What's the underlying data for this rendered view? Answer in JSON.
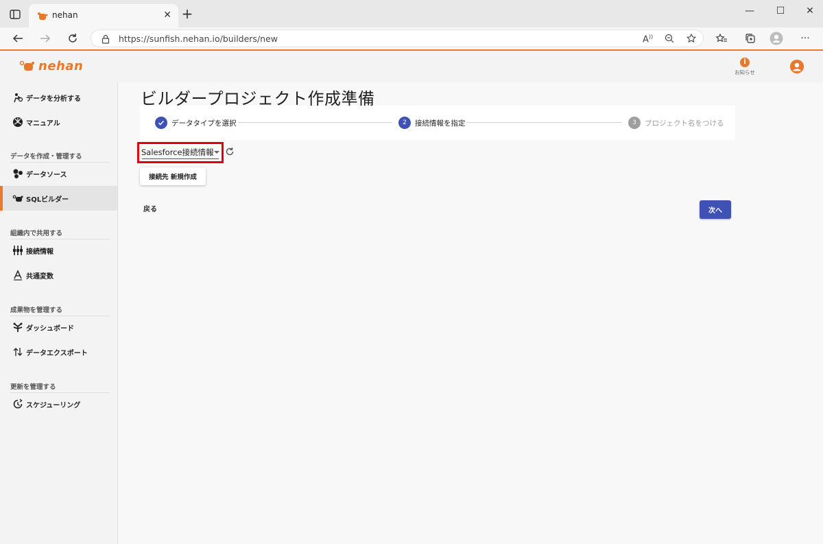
{
  "browser": {
    "tab_title": "nehan",
    "url": "https://sunfish.nehan.io/builders/new",
    "new_tab_symbol": "+",
    "close_symbol": "✕",
    "minimize_symbol": "—",
    "maximize_symbol": "☐",
    "window_close_symbol": "✕"
  },
  "header": {
    "logo_text": "nehan",
    "notification_label": "お知らせ",
    "notification_symbol": "i"
  },
  "sidebar": {
    "top_items": [
      {
        "label": "データを分析する",
        "icon": "analyze-icon"
      },
      {
        "label": "マニュアル",
        "icon": "manual-icon"
      }
    ],
    "sections": [
      {
        "title": "データを作成・管理する"
      },
      {
        "title": "組織内で共用する"
      },
      {
        "title": "成果物を管理する"
      },
      {
        "title": "更新を管理する"
      }
    ],
    "items": {
      "datasource": "データソース",
      "sql_builder": "SQLビルダー",
      "connections": "接続情報",
      "shared_vars": "共通変数",
      "dashboard": "ダッシュボード",
      "export": "データエクスポート",
      "scheduling": "スケジューリング"
    }
  },
  "main": {
    "title": "ビルダープロジェクト作成準備",
    "steps": [
      {
        "number": "✓",
        "label": "データタイプを選択",
        "state": "done"
      },
      {
        "number": "2",
        "label": "接続情報を指定",
        "state": "active"
      },
      {
        "number": "3",
        "label": "プロジェクト名をつける",
        "state": "pending"
      }
    ],
    "connection_select_value": "Salesforce接続情報",
    "new_connection_button": "接続先 新規作成",
    "back_button": "戻る",
    "next_button": "次へ"
  },
  "colors": {
    "accent": "#e8782c",
    "primary": "#3f51b5",
    "highlight": "#e0000b",
    "step_pending": "#9e9e9e"
  }
}
